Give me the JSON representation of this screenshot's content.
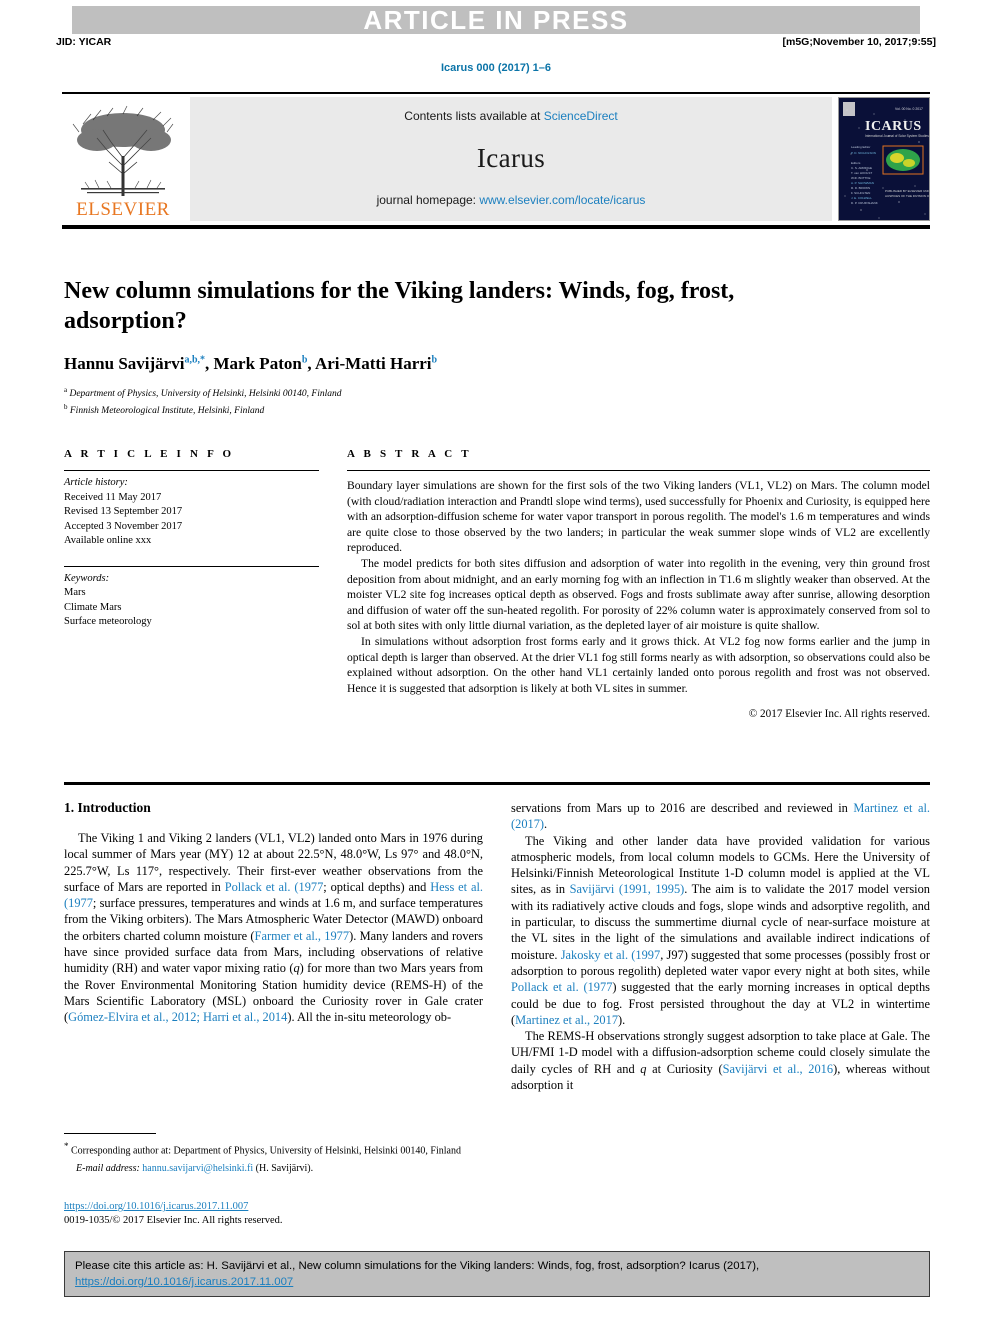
{
  "banner": {
    "press_label": "ARTICLE IN PRESS",
    "jid": "JID: YICAR",
    "build_stamp": "[m5G;November 10, 2017;9:55]",
    "journal_ref": "Icarus 000 (2017) 1–6"
  },
  "masthead": {
    "contents_prefix": "Contents lists available at ",
    "contents_link": "ScienceDirect",
    "journal_name": "Icarus",
    "homepage_prefix": "journal homepage: ",
    "homepage_link": "www.elsevier.com/locate/icarus",
    "publisher_logo_text": "ELSEVIER",
    "cover_title": "ICARUS",
    "cover_subtitle": "International Journal of Solar System Studies"
  },
  "article": {
    "title": "New column simulations for the Viking landers: Winds, fog, frost, adsorption?",
    "authors": [
      {
        "name": "Hannu Savijärvi",
        "marks": "a,b,*"
      },
      {
        "name": "Mark Paton",
        "marks": "b"
      },
      {
        "name": "Ari-Matti Harri",
        "marks": "b"
      }
    ],
    "affiliations": [
      {
        "mark": "a",
        "text": "Department of Physics, University of Helsinki, Helsinki 00140, Finland"
      },
      {
        "mark": "b",
        "text": "Finnish Meteorological Institute, Helsinki, Finland"
      }
    ]
  },
  "info": {
    "heading": "A R T I C L E   I N F O",
    "history_label": "Article history:",
    "history": [
      "Received 11 May 2017",
      "Revised 13 September 2017",
      "Accepted 3 November 2017",
      "Available online xxx"
    ],
    "keywords_label": "Keywords:",
    "keywords": [
      "Mars",
      "Climate Mars",
      "Surface meteorology"
    ]
  },
  "abstract": {
    "heading": "A B S T R A C T",
    "paragraphs": [
      "Boundary layer simulations are shown for the first sols of the two Viking landers (VL1, VL2) on Mars. The column model (with cloud/radiation interaction and Prandtl slope wind terms), used successfully for Phoenix and Curiosity, is equipped here with an adsorption-diffusion scheme for water vapor transport in porous regolith. The model's 1.6 m temperatures and winds are quite close to those observed by the two landers; in particular the weak summer slope winds of VL2 are excellently reproduced.",
      "The model predicts for both sites diffusion and adsorption of water into regolith in the evening, very thin ground frost deposition from about midnight, and an early morning fog with an inflection in T1.6 m slightly weaker than observed. At the moister VL2 site fog increases optical depth as observed. Fogs and frosts sublimate away after sunrise, allowing desorption and diffusion of water off the sun-heated regolith. For porosity of 22% column water is approximately conserved from sol to sol at both sites with only little diurnal variation, as the depleted layer of air moisture is quite shallow.",
      "In simulations without adsorption frost forms early and it grows thick. At VL2 fog now forms earlier and the jump in optical depth is larger than observed. At the drier VL1 fog still forms nearly as with adsorption, so observations could also be explained without adsorption. On the other hand VL1 certainly landed onto porous regolith and frost was not observed. Hence it is suggested that adsorption is likely at both VL sites in summer."
    ],
    "copyright": "© 2017 Elsevier Inc. All rights reserved."
  },
  "intro": {
    "heading": "1. Introduction",
    "left_para_1_a": "The Viking 1 and Viking 2 landers (VL1, VL2) landed onto Mars in 1976 during local summer of Mars year (MY) 12 at about 22.5°N, 48.0°W, Ls 97° and 48.0°N, 225.7°W, Ls 117°, respectively. Their first-ever weather observations from the surface of Mars are reported in ",
    "cite_pollack_1977a": "Pollack et al. (1977",
    "left_para_1_b": "; optical depths) and ",
    "cite_hess_1977": "Hess et al. (1977",
    "left_para_1_c": "; surface pressures, temperatures and winds at 1.6 m, and surface temperatures from the Viking orbiters). The Mars Atmospheric Water Detector (MAWD) onboard the orbiters charted column moisture (",
    "cite_farmer_1977": "Farmer et al., 1977",
    "left_para_1_d": "). Many landers and rovers have since provided surface data from Mars, including observations of relative humidity (RH) and water vapor mixing ratio (",
    "var_q": "q",
    "left_para_1_e": ") for more than two Mars years from the Rover Environmental Monitoring Station humidity device (REMS-H) of the Mars Scientific Laboratory (MSL) onboard the Curiosity rover in Gale crater (",
    "cite_gomez_harri": "Gómez-Elvira et al., 2012; Harri et al., 2014",
    "left_para_1_f": "). All the in-situ meteorology ob-",
    "right_para_1_a": "servations from Mars up to 2016 are described and reviewed in ",
    "cite_martinez_2017a": "Martinez et al. (2017)",
    "right_para_1_b": ".",
    "right_para_2_a": "The Viking and other lander data have provided validation for various atmospheric models, from local column models to GCMs. Here the University of Helsinki/Finnish Meteorological Institute 1-D column model is applied at the VL sites, as in ",
    "cite_savijarvi_1991": "Savijärvi (1991, 1995)",
    "right_para_2_b": ". The aim is to validate the 2017 model version with its radiatively active clouds and fogs, slope winds and adsorptive regolith, and in particular, to discuss the summertime diurnal cycle of near-surface moisture at the VL sites in the light of the simulations and available indirect indications of moisture. ",
    "cite_jakosky_1997": "Jakosky et al. (1997",
    "right_para_2_c": ", J97) suggested that some processes (possibly frost or adsorption to porous regolith) depleted water vapor every night at both sites, while ",
    "cite_pollack_1977b": "Pollack et al. (1977",
    "right_para_2_d": ") suggested that the early morning increases in optical depths could be due to fog. Frost persisted throughout the day at VL2 in wintertime (",
    "cite_martinez_2017b": "Martinez et al., 2017",
    "right_para_2_e": ").",
    "right_para_3_a": "The REMS-H observations strongly suggest adsorption to take place at Gale. The UH/FMI 1-D model with a diffusion-adsorption scheme could closely simulate the daily cycles of RH and ",
    "right_para_3_b": " at Curiosity (",
    "cite_savijarvi_2016": "Savijärvi et al., 2016",
    "right_para_3_c": "), whereas without adsorption it"
  },
  "footnote": {
    "star": "*",
    "corresponding": " Corresponding author at: Department of Physics, University of Helsinki, Helsinki 00140, Finland",
    "email_label": "E-mail address:",
    "email": "hannu.savijarvi@helsinki.fi",
    "email_person": " (H. Savijärvi)."
  },
  "doi_block": {
    "doi_url": "https://doi.org/10.1016/j.icarus.2017.11.007",
    "issn_line": "0019-1035/© 2017 Elsevier Inc. All rights reserved."
  },
  "cite_box": {
    "text": "Please cite this article as: H. Savijärvi et al., New column simulations for the Viking landers: Winds, fog, frost, adsorption? Icarus (2017),",
    "doi_url": "https://doi.org/10.1016/j.icarus.2017.11.007"
  },
  "colors": {
    "link": "#1b7fbf",
    "banner_gray": "#bfbfbf",
    "masthead_gray": "#eaeaea",
    "elsevier_orange": "#e87722"
  }
}
